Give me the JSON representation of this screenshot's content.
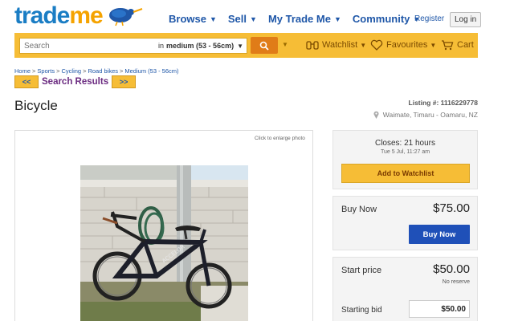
{
  "brand": {
    "trade": "trade",
    "me": "me",
    "logo_icon": "kiwi-icon",
    "trade_color": "#1a7dc4",
    "me_color": "#f5a300"
  },
  "topnav": {
    "items": [
      {
        "label": "Browse"
      },
      {
        "label": "Sell"
      },
      {
        "label": "My Trade Me"
      },
      {
        "label": "Community"
      }
    ],
    "register": "Register",
    "login": "Log in"
  },
  "search": {
    "placeholder": "Search",
    "scope_prefix": "in",
    "scope_value": "medium (53 - 56cm)",
    "button_icon": "search-icon",
    "bar_color": "#f6bd36",
    "button_color": "#e07c18"
  },
  "searchbar_links": {
    "watchlist": "Watchlist",
    "favourites": "Favourites",
    "cart": "Cart"
  },
  "breadcrumb": [
    "Home",
    "Sports",
    "Cycling",
    "Road bikes",
    "Medium (53 - 56cm)"
  ],
  "results_nav": {
    "prev": "<<",
    "label": "Search Results",
    "next": ">>"
  },
  "listing": {
    "title": "Bicycle",
    "number": "Listing #: 1116229778",
    "location": "Waimate, Timaru - Oamaru, NZ",
    "enlarge": "Click to enlarge photo"
  },
  "closing": {
    "closes": "Closes: 21 hours",
    "date": "Tue 5 Jul, 11:27 am",
    "watchlist_button": "Add to Watchlist"
  },
  "buy_now": {
    "label": "Buy Now",
    "price": "$75.00",
    "button": "Buy Now",
    "button_color": "#1f50b8"
  },
  "bidding": {
    "start_label": "Start price",
    "start_price": "$50.00",
    "reserve": "No reserve",
    "bid_label": "Starting bid",
    "bid_value": "$50.00"
  }
}
